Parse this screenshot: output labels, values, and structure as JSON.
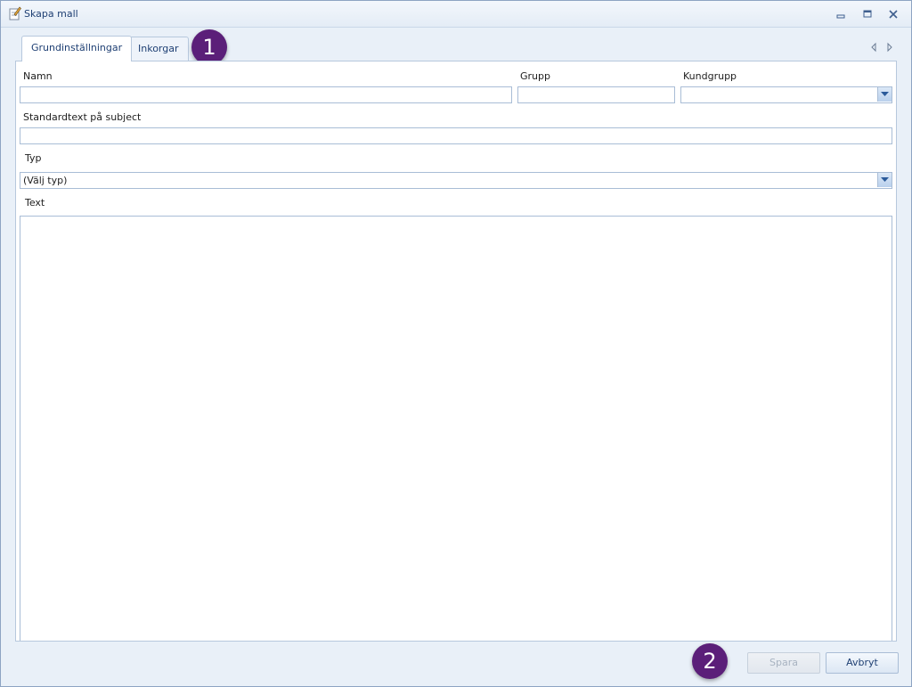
{
  "window": {
    "title": "Skapa mall",
    "app_icon": "edit-note-icon",
    "controls": [
      "minimize-icon",
      "restore-icon",
      "close-icon"
    ]
  },
  "tabs": [
    {
      "label": "Grundinställningar",
      "active": true
    },
    {
      "label": "Inkorgar",
      "active": false
    }
  ],
  "form": {
    "name_label": "Namn",
    "name_value": "",
    "group_label": "Grupp",
    "group_value": "",
    "customer_group_label": "Kundgrupp",
    "customer_group_value": "",
    "subject_label": "Standardtext på subject",
    "subject_value": "",
    "type_label": "Typ",
    "type_value": "(Välj typ)",
    "text_label": "Text",
    "text_value": ""
  },
  "callouts": [
    "1",
    "2"
  ],
  "buttons": {
    "save_label": "Spara",
    "cancel_label": "Avbryt"
  },
  "colors": {
    "accent": "#1e3f73",
    "callout": "#5b1f79",
    "border": "#a9bdd6"
  }
}
